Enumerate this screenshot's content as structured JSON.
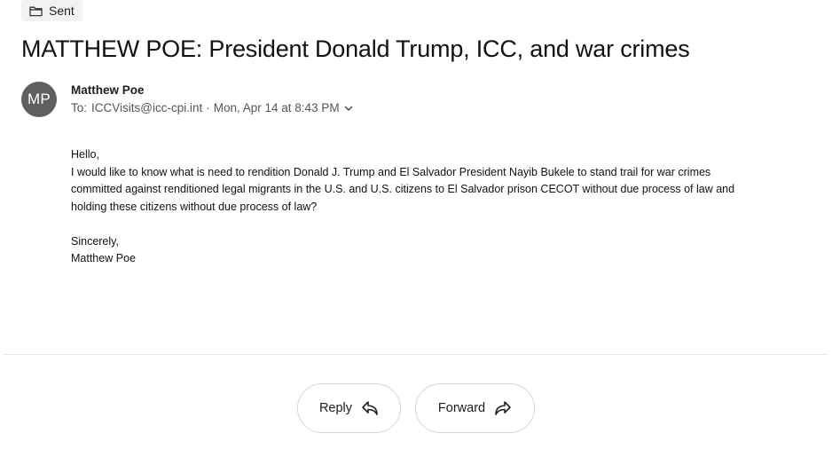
{
  "folder": {
    "icon": "folder-icon",
    "label": "Sent"
  },
  "message": {
    "subject": "MATTHEW POE: President Donald Trump, ICC, and war crimes",
    "sender": {
      "initials": "MP",
      "name": "Matthew Poe",
      "avatar_color": "#5f5f5f"
    },
    "to_label": "To:",
    "recipient": "ICCVisits@icc-cpi.int",
    "separator": "·",
    "date": "Mon, Apr 14 at 8:43 PM",
    "details_icon": "chevron-down-icon",
    "body": {
      "greeting": "Hello,",
      "paragraph": "I would like to know what is need to rendition Donald J. Trump and El Salvador President Nayib Bukele to stand trail for war crimes committed against renditioned legal migrants in the U.S. and U.S. citizens to El Salvador prison CECOT without due process of law and holding these citizens without due process of law?",
      "closing": "Sincerely,",
      "signature": "Matthew Poe"
    }
  },
  "actions": {
    "reply": {
      "label": "Reply",
      "icon": "reply-icon"
    },
    "forward": {
      "label": "Forward",
      "icon": "forward-icon"
    }
  }
}
